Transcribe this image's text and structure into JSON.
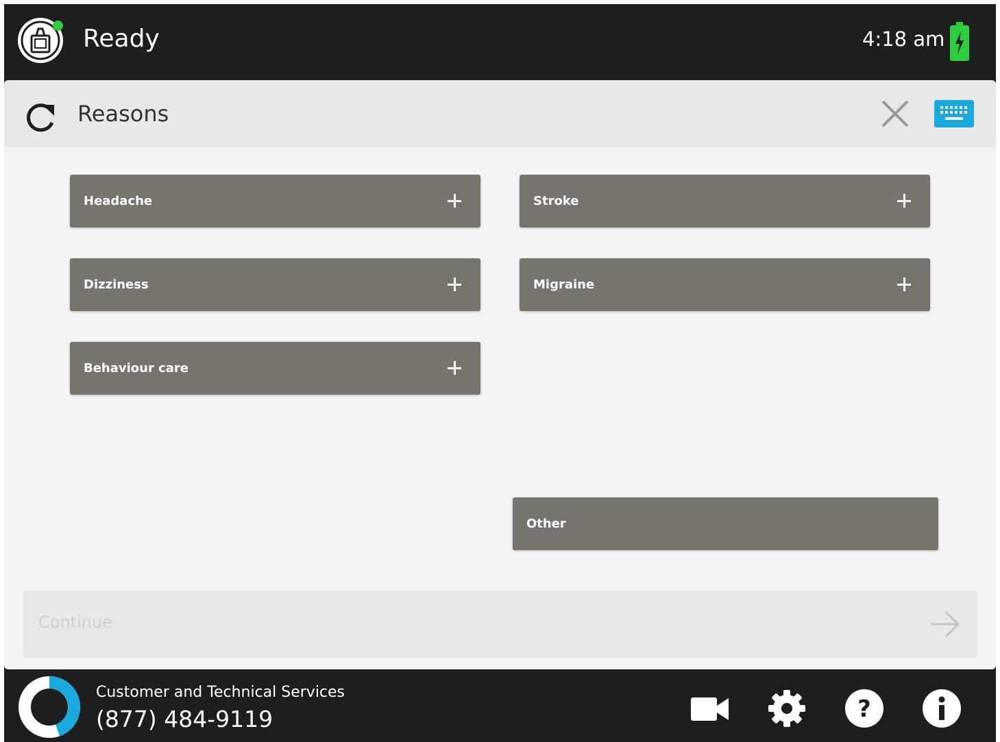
{
  "header": {
    "status": "Ready",
    "time": "4:18 am",
    "status_color": "#2ecc40",
    "battery_color": "#2ecc40"
  },
  "panel": {
    "title": "Reasons",
    "keyboard_color": "#1aa9dc",
    "reasons": [
      {
        "label": "Headache"
      },
      {
        "label": "Stroke"
      },
      {
        "label": "Dizziness"
      },
      {
        "label": "Migraine"
      },
      {
        "label": "Behaviour care"
      },
      {
        "label": "Other"
      }
    ],
    "continue_label": "Continue"
  },
  "footer": {
    "service_title": "Customer and Technical Services",
    "phone": "(877) 484-9119",
    "icons": [
      "video-camera-icon",
      "gear-icon",
      "help-icon",
      "info-icon"
    ]
  },
  "colors": {
    "button_bg": "#79736e",
    "bar_bg": "#1e1e1e",
    "accent": "#1aa9dc"
  }
}
